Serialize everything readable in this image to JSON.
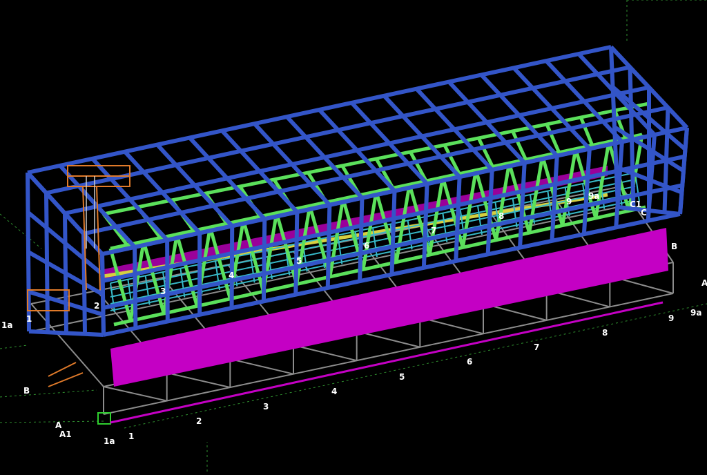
{
  "grid_labels": {
    "bottom_axis": [
      "1",
      "2",
      "3",
      "4",
      "5",
      "6",
      "7",
      "8",
      "9",
      "9a"
    ],
    "bottom_axis_1a": "1a",
    "left_side": [
      "1a",
      "1",
      "B",
      "A",
      "A1"
    ],
    "right_side": [
      "A",
      "9a"
    ],
    "upper_frame": [
      "2",
      "3",
      "4",
      "5",
      "6",
      "7",
      "8",
      "9",
      "9a",
      "C1",
      "C",
      "B"
    ]
  },
  "colors": {
    "background": "#000000",
    "frame_blue": "#3355c8",
    "truss_green": "#5be05b",
    "purlin_cyan": "#37b9c8",
    "cladding_magenta": "#c400c4",
    "deck_gray": "#8c8c8c",
    "orange_stair": "#e07a2a",
    "yellow_beam": "#d6d040",
    "grid_green": "#2f8f2f"
  }
}
